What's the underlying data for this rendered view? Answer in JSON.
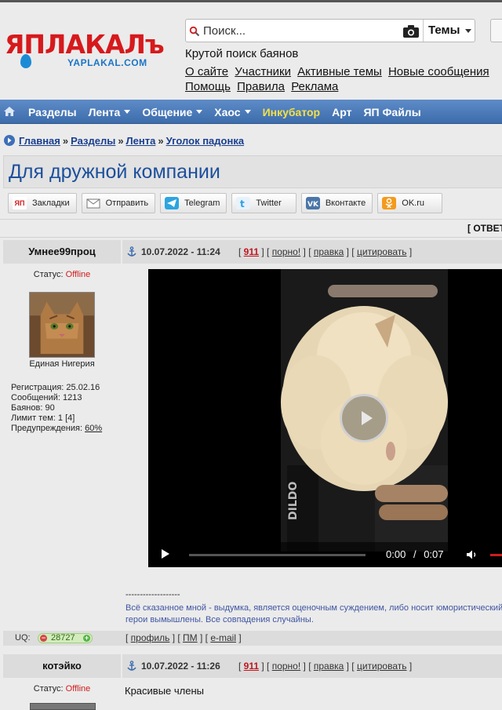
{
  "header": {
    "logo_main": "ЯПЛАКАЛъ",
    "logo_sub": "YAPLAKAL.COM",
    "search": {
      "placeholder": "Поиск..."
    },
    "themes_label": "Темы",
    "tagline": "Крутой поиск баянов",
    "links": [
      "О сайте",
      "Участники",
      "Активные темы",
      "Новые сообщения",
      "Помощь",
      "Правила",
      "Реклама"
    ]
  },
  "nav": {
    "items": [
      "Разделы",
      "Лента",
      "Общение",
      "Хаос",
      "Инкубатор",
      "Арт",
      "ЯП Файлы"
    ],
    "highlight_color": "#f3e04a",
    "bar_color": "#4a78b8"
  },
  "breadcrumb": [
    "Главная",
    "Разделы",
    "Лента",
    "Уголок падонка"
  ],
  "topic": {
    "title": "Для дружной компании"
  },
  "share": [
    "Закладки",
    "Отправить",
    "Telegram",
    "Twitter",
    "Вконтакте",
    "OK.ru"
  ],
  "reply": {
    "label": "[ ОТВЕТ"
  },
  "posts": [
    {
      "author": "Умнее99проц",
      "date": "10.07.2022 - 11:24",
      "count": "911",
      "actions": [
        "порно!",
        "правка",
        "цитировать"
      ],
      "status_label": "Статус:",
      "status_value": "Offline",
      "group": "Единая Нигерия",
      "stats": {
        "reg_label": "Регистрация:",
        "reg": "25.02.16",
        "msgs_label": "Сообщений:",
        "msgs": "1213",
        "bayans_label": "Баянов:",
        "bayans": "90",
        "limit_label": "Лимит тем:",
        "limit": "1 [4]",
        "warn_label": "Предупреждения:",
        "warn": "60%"
      },
      "video": {
        "time_current": "0:00",
        "time_sep": "/",
        "time_total": "0:07",
        "progress": 0
      },
      "signature_dash": "-------------------",
      "signature": "Всё сказанное мной - выдумка, является оценочным суждением, либо носит юмористический характер.",
      "signature2": "герои вымышлены. Все совпадения случайны.",
      "uq_label": "UQ:",
      "uq_value": "28727",
      "profile_links": [
        "профиль",
        "ПМ",
        "e-mail"
      ]
    },
    {
      "author": "котэйко",
      "date": "10.07.2022 - 11:26",
      "count": "911",
      "actions": [
        "порно!",
        "правка",
        "цитировать"
      ],
      "status_label": "Статус:",
      "status_value": "Offline",
      "text": "Красивые члены"
    }
  ]
}
